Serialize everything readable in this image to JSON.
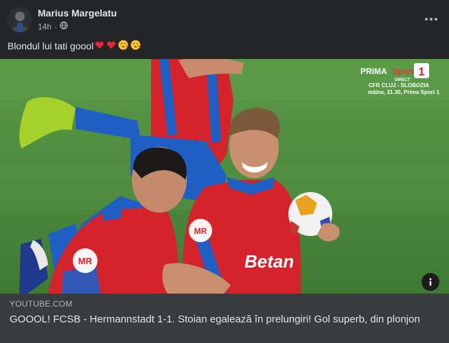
{
  "post": {
    "author": "Marius Margelatu",
    "time": "14h",
    "caption": "Blondul lui tati goool",
    "caption_emojis": [
      "heart-emoji",
      "heart-emoji",
      "kissing-face-emoji",
      "kissing-face-emoji"
    ]
  },
  "broadcast": {
    "channel_name": "PRIMA",
    "channel_sport": "Sport",
    "channel_number": "1",
    "channel_tag": "DIRECT",
    "next_match": "CFR CLUJ - SLOBOZIA",
    "next_when": "mâine, 21.30, Prima Sport 1"
  },
  "jersey_text": {
    "sponsor": "Betan",
    "badge": "MR"
  },
  "link": {
    "domain": "YOUTUBE.COM",
    "title": "GOOOL! FCSB - Hermannstadt 1-1. Stoian egalează în prelungiri! Gol superb, din plonjon"
  },
  "colors": {
    "background": "#242526",
    "card": "#3a3b3c",
    "pitch": "#4d8a3e",
    "jersey_red": "#d4232b",
    "jersey_blue": "#1f5fc4",
    "emoji_heart": "#e3263c"
  }
}
